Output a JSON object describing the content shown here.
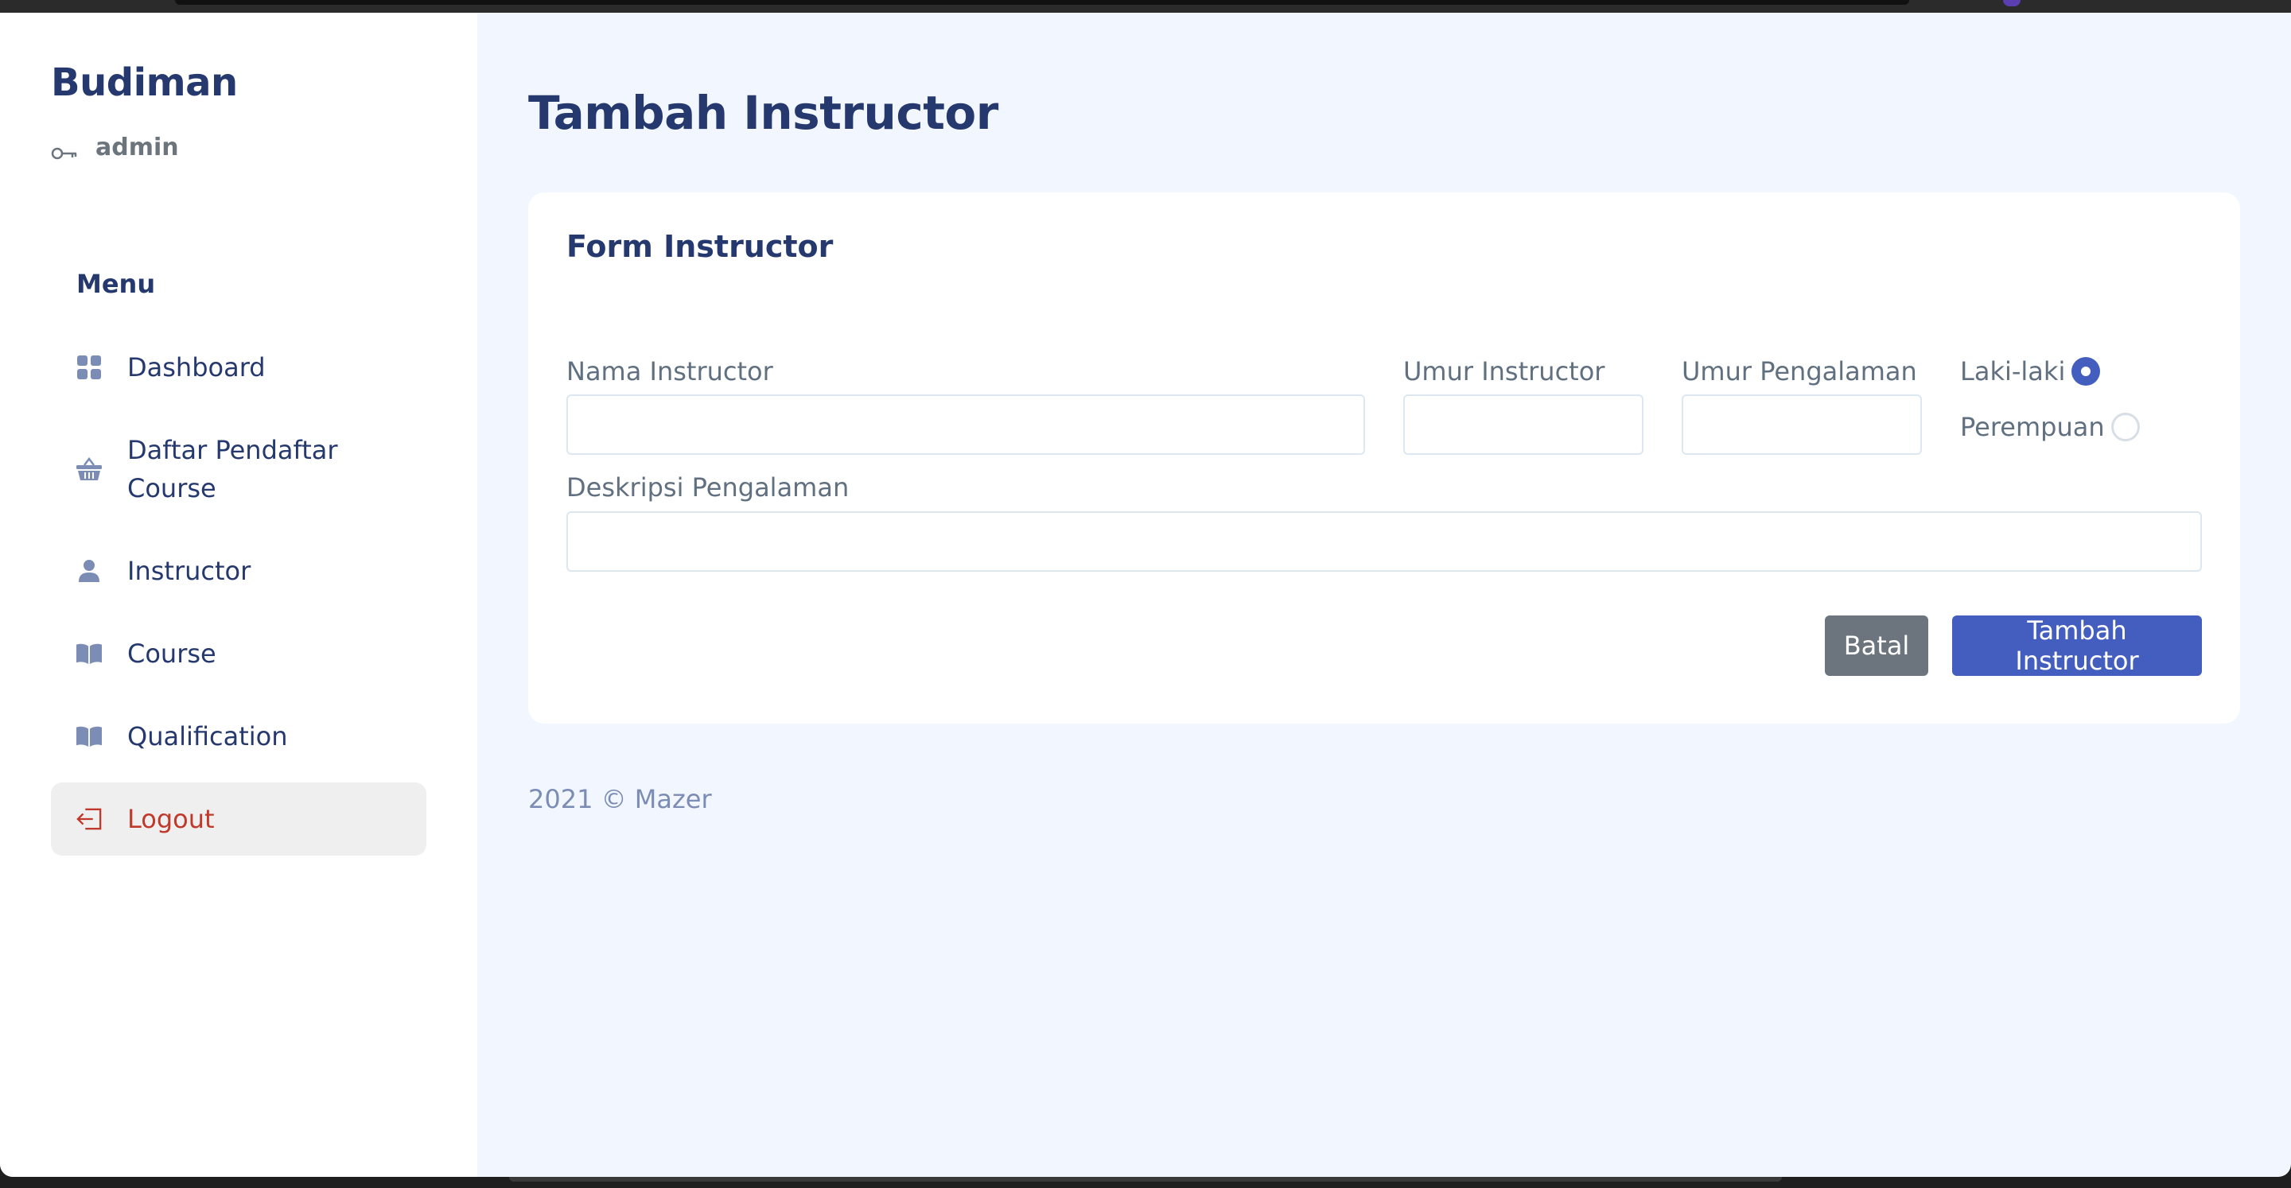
{
  "sidebar": {
    "brand": "Budiman",
    "role": "admin",
    "role_icon": "key-icon",
    "menu_title": "Menu",
    "items": [
      {
        "label": "Dashboard",
        "icon": "grid-icon"
      },
      {
        "label": "Daftar Pendaftar Course",
        "icon": "basket-icon"
      },
      {
        "label": "Instructor",
        "icon": "person-icon"
      },
      {
        "label": "Course",
        "icon": "book-icon"
      },
      {
        "label": "Qualification",
        "icon": "book-icon"
      },
      {
        "label": "Logout",
        "icon": "logout-icon"
      }
    ]
  },
  "main": {
    "page_title": "Tambah Instructor",
    "form": {
      "title": "Form Instructor",
      "nama_label": "Nama Instructor",
      "nama_value": "",
      "umur_label": "Umur Instructor",
      "umur_value": "",
      "pengalaman_label": "Umur Pengalaman",
      "pengalaman_value": "",
      "gender_options": [
        {
          "label": "Laki-laki",
          "checked": true
        },
        {
          "label": "Perempuan",
          "checked": false
        }
      ],
      "deskripsi_label": "Deskripsi Pengalaman",
      "deskripsi_value": "",
      "cancel_label": "Batal",
      "submit_label": "Tambah Instructor"
    },
    "footer": "2021 © Mazer"
  },
  "colors": {
    "primary": "#435ebe",
    "title": "#25396f",
    "background": "#f2f7ff",
    "logout": "#c0392b",
    "cancel": "#6c757d"
  }
}
